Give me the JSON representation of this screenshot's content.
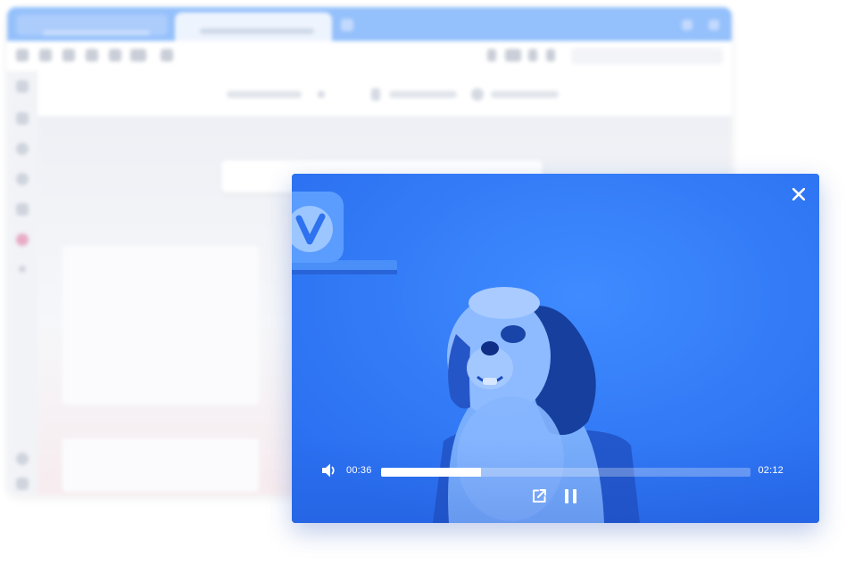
{
  "player": {
    "current_time": "00:36",
    "total_time": "02:12",
    "progress_fraction": 0.27,
    "is_playing": true,
    "accent_color": "#2d78f6"
  },
  "icons": {
    "close": "close-icon",
    "volume": "speaker-icon",
    "popout": "external-link-icon",
    "pause": "pause-icon",
    "logo": "vivaldi-logo-icon"
  },
  "background_browser": {
    "tabbar_color": "#8fbdfb",
    "blurred": true
  }
}
